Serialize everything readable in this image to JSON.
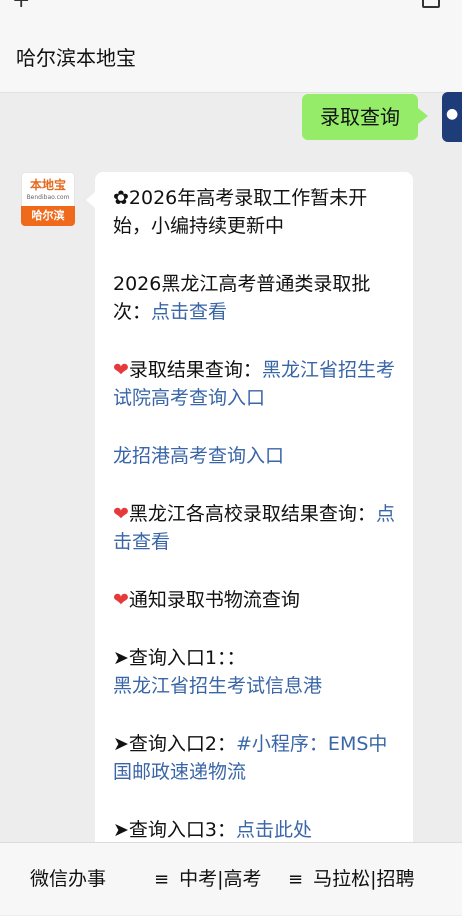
{
  "header": {
    "title": "哈尔滨本地宝",
    "plus_icon": "plus-icon",
    "corner_icon": "window-icon"
  },
  "outgoing": {
    "text": "录取查询"
  },
  "bot": {
    "avatar": {
      "brand_top": "本地宝",
      "brand_site": "Bendibao.com",
      "brand_bottom": "哈尔滨"
    },
    "message": {
      "p1": "✿2026年高考录取工作暂未开始，小编持续更新中",
      "p2_text": "2026黑龙江高考普通类录取批次：",
      "p2_link": "点击查看",
      "p3_heart": "❤",
      "p3_text": "录取结果查询：",
      "p3_link": "黑龙江省招生考试院高考查询入口",
      "p4_link": "龙招港高考查询入口",
      "p5_heart": "❤",
      "p5_text": "黑龙江各高校录取结果查询：",
      "p5_link": "点击查看",
      "p6_heart": "❤",
      "p6_text": "通知录取书物流查询",
      "p7_text": "➤查询入口1：：",
      "p7_link": "黑龙江省招生考试信息港",
      "p8_text": "➤查询入口2：",
      "p8_link": "#小程序：EMS中国邮政速递物流",
      "p9_text": "➤查询入口3：",
      "p9_link": "点击此处"
    }
  },
  "menu": {
    "items": [
      {
        "label": "微信办事",
        "icon": ""
      },
      {
        "label": "中考|高考",
        "icon": "≡"
      },
      {
        "label": "马拉松|招聘",
        "icon": "≡"
      }
    ]
  }
}
